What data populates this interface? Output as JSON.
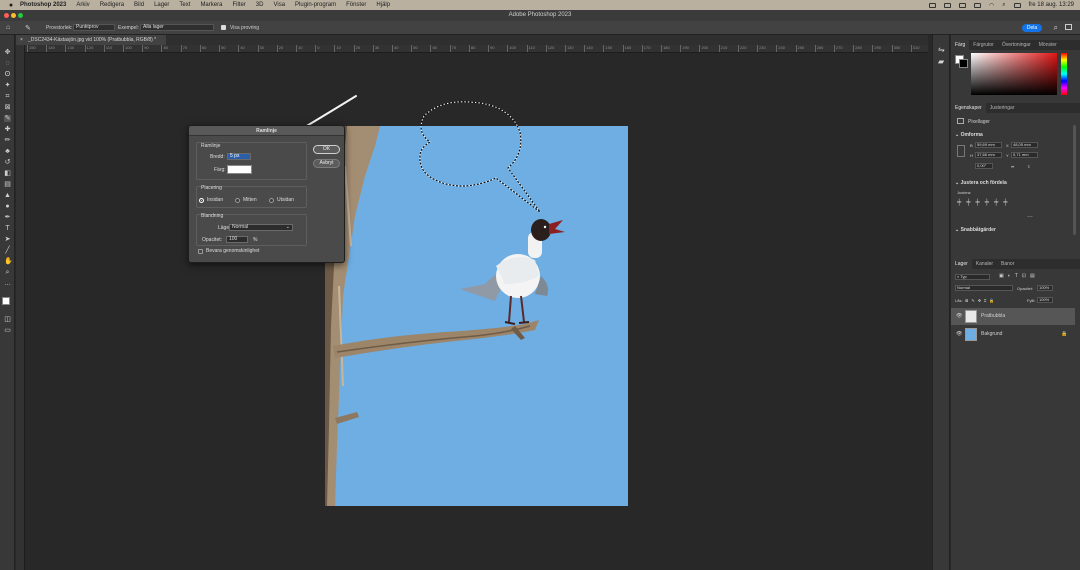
{
  "menubar": {
    "app_name": "Photoshop 2023",
    "items": [
      "Arkiv",
      "Redigera",
      "Bild",
      "Lager",
      "Text",
      "Markera",
      "Filter",
      "3D",
      "Visa",
      "Plugin-program",
      "Fönster",
      "Hjälp"
    ],
    "clock": "fre 18 aug. 13:29"
  },
  "window": {
    "title": "Adobe Photoshop 2023"
  },
  "options_bar": {
    "sample_size_label": "Provstorlek:",
    "sample_size_value": "Punktprov",
    "sample_label": "Exempel:",
    "sample_value": "Alla lager",
    "show_ring_label": "Visa provring",
    "share_label": "Dela"
  },
  "document": {
    "tab_title": "_DSC2434-Kästasjön.jpg vid 100% (Pratbubbla, RGB/8) *",
    "ruler_ticks": [
      "150",
      "140",
      "130",
      "120",
      "110",
      "100",
      "90",
      "80",
      "70",
      "60",
      "50",
      "40",
      "30",
      "20",
      "10",
      "0",
      "10",
      "20",
      "30",
      "40",
      "50",
      "60",
      "70",
      "80",
      "90",
      "100",
      "110",
      "120",
      "130",
      "140",
      "150",
      "160",
      "170",
      "180",
      "190",
      "200",
      "210",
      "220",
      "230",
      "240",
      "250",
      "260",
      "270",
      "280",
      "290",
      "300",
      "310"
    ]
  },
  "dialog": {
    "title": "Ramlinje",
    "group_stroke": "Ramlinje",
    "width_label": "Bredd:",
    "width_value": "5 px",
    "color_label": "Färg:",
    "color_value": "#ffffff",
    "group_placement": "Placering",
    "placement_options": [
      "Insidan",
      "Mitten",
      "Utsidan"
    ],
    "placement_selected": "Insidan",
    "group_blend": "Blandning",
    "mode_label": "Läge:",
    "mode_value": "Normal",
    "opacity_label": "Opacitet:",
    "opacity_value": "100",
    "opacity_unit": "%",
    "preserve_label": "Bevara genomskinlighet",
    "ok_label": "OK",
    "cancel_label": "Avbryt"
  },
  "color_panel": {
    "tabs": [
      "Färg",
      "Färgrutor",
      "Övertoningar",
      "Mönster"
    ]
  },
  "properties_panel": {
    "tabs": [
      "Egenskaper",
      "Justeringar"
    ],
    "layer_type": "Pixellager",
    "transform_title": "Omforma",
    "b_label": "B",
    "b_value": "59,69 mm",
    "x_label": "X",
    "x_value": "48,05 mm",
    "h_label": "H",
    "h_value": "37,66 mm",
    "y_label": "Y",
    "y_value": "5,71 mm",
    "angle_value": "0,00°",
    "align_title": "Justera och fördela",
    "align_label": "Justera:",
    "quick_title": "Snabbåtgärder"
  },
  "layers_panel": {
    "tabs": [
      "Lager",
      "Kanaler",
      "Banor"
    ],
    "kind_label": "Typ",
    "blend_mode": "Normal",
    "opacity_label": "Opacitet:",
    "opacity_value": "100%",
    "lock_label": "Lås:",
    "fill_label": "Fyllt:",
    "fill_value": "100%",
    "layers": [
      {
        "name": "Pratbubbla",
        "selected": true
      },
      {
        "name": "Bakgrund",
        "selected": false
      }
    ]
  },
  "colors": {
    "photo_sky": "#6eaee3",
    "accent": "#1473e6"
  }
}
